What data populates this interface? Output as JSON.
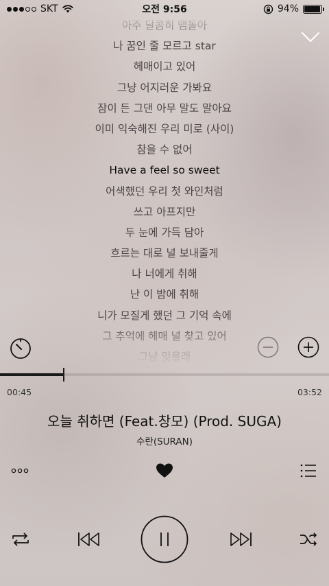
{
  "status_bar": {
    "carrier": "SKT",
    "time": "오전 9:56",
    "battery_percent": "94%",
    "battery_level": 0.94,
    "signal_bars_filled": 3,
    "signal_bars_total": 5
  },
  "lyrics": {
    "lines": [
      "아주 달콤히 맴돌아",
      "나 꿈인 줄 모르고 star",
      "헤매이고 있어",
      "그냥 어지러운 가봐요",
      "잠이 든 그댄 아무 말도 말아요",
      "이미 익숙해진 우리 미로 (사이)",
      "참을 수 없어",
      "Have a feel so sweet",
      "어색했던 우리 첫 와인처럼",
      "쓰고 아프지만",
      "두 눈에 가득 담아",
      "흐르는 대로 널 보내줄게",
      "나 너에게 취해",
      "난 이 밤에 취해",
      "니가 모질게 했던 그 기억 속에",
      "그 추억에 헤매 널 찾고 있어",
      "그냥 잊을래"
    ],
    "current_index": 7
  },
  "player": {
    "elapsed": "00:45",
    "total": "03:52",
    "progress": 0.194,
    "title": "오늘 취하면 (Feat.창모) (Prod. SUGA)",
    "artist": "수란(SURAN)",
    "liked": true
  },
  "icons": {
    "collapse": "chevron-down-icon",
    "timer": "timer-icon",
    "minus": "minus-circle-icon",
    "plus": "plus-circle-icon",
    "more": "more-dots-icon",
    "like": "heart-icon",
    "playlist": "playlist-icon",
    "repeat": "repeat-icon",
    "prev": "previous-icon",
    "pause": "pause-icon",
    "next": "next-icon",
    "shuffle": "shuffle-icon"
  },
  "colors": {
    "text": "#111111",
    "accent": "#1a1a1a"
  }
}
